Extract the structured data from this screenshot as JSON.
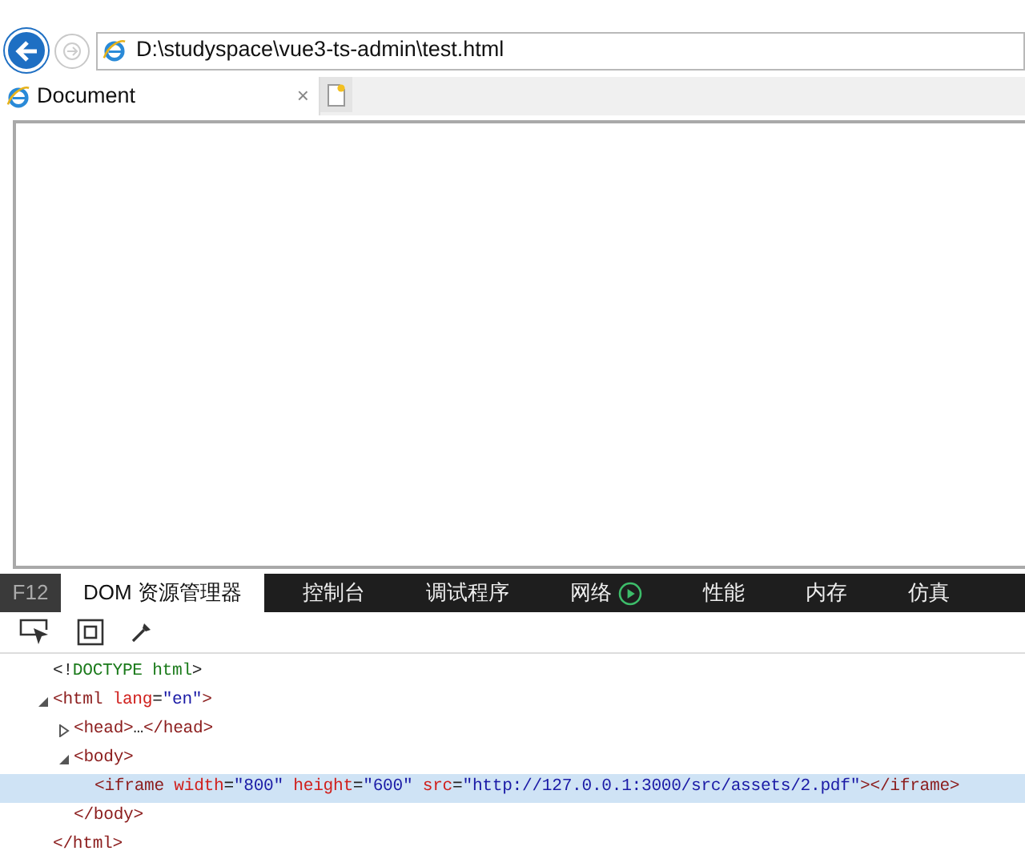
{
  "address_bar": {
    "url": "D:\\studyspace\\vue3-ts-admin\\test.html"
  },
  "tabs": [
    {
      "label": "Document",
      "close": "×",
      "selected": true
    }
  ],
  "devtools": {
    "f12_label": "F12",
    "tabs": [
      {
        "label": "DOM 资源管理器",
        "selected": true
      },
      {
        "label": "控制台",
        "selected": false
      },
      {
        "label": "调试程序",
        "selected": false
      },
      {
        "label": "网络",
        "selected": false,
        "recording": true
      },
      {
        "label": "性能",
        "selected": false
      },
      {
        "label": "内存",
        "selected": false
      },
      {
        "label": "仿真",
        "selected": false
      }
    ],
    "dom_tree": [
      {
        "selected": false,
        "tokens": [
          {
            "kind": "punct",
            "text": "<!"
          },
          {
            "kind": "doctype",
            "text": "DOCTYPE html"
          },
          {
            "kind": "punct",
            "text": ">"
          }
        ]
      },
      {
        "selected": false,
        "expanded": true,
        "tokens": [
          {
            "kind": "tag",
            "text": "<html"
          },
          {
            "kind": "attr",
            "text": " lang"
          },
          {
            "kind": "punct",
            "text": "="
          },
          {
            "kind": "value",
            "text": "\"en\""
          },
          {
            "kind": "tag",
            "text": ">"
          }
        ],
        "children": [
          {
            "selected": false,
            "expanded": false,
            "tokens": [
              {
                "kind": "tag",
                "text": "<head>"
              },
              {
                "kind": "punct",
                "text": "…"
              },
              {
                "kind": "tag",
                "text": "</head>"
              }
            ]
          },
          {
            "selected": false,
            "expanded": true,
            "tokens": [
              {
                "kind": "tag",
                "text": "<body>"
              }
            ],
            "children": [
              {
                "selected": true,
                "tokens": [
                  {
                    "kind": "tag",
                    "text": "<iframe"
                  },
                  {
                    "kind": "attr",
                    "text": " width"
                  },
                  {
                    "kind": "punct",
                    "text": "="
                  },
                  {
                    "kind": "value",
                    "text": "\"800\""
                  },
                  {
                    "kind": "attr",
                    "text": " height"
                  },
                  {
                    "kind": "punct",
                    "text": "="
                  },
                  {
                    "kind": "value",
                    "text": "\"600\""
                  },
                  {
                    "kind": "attr",
                    "text": " src"
                  },
                  {
                    "kind": "punct",
                    "text": "="
                  },
                  {
                    "kind": "value",
                    "text": "\"http://127.0.0.1:3000/src/assets/2.pdf\""
                  },
                  {
                    "kind": "tag",
                    "text": "></iframe>"
                  }
                ]
              }
            ],
            "closing": [
              {
                "kind": "tag",
                "text": "</body>"
              }
            ]
          }
        ],
        "closing": [
          {
            "kind": "tag",
            "text": "</html>"
          }
        ]
      }
    ]
  }
}
